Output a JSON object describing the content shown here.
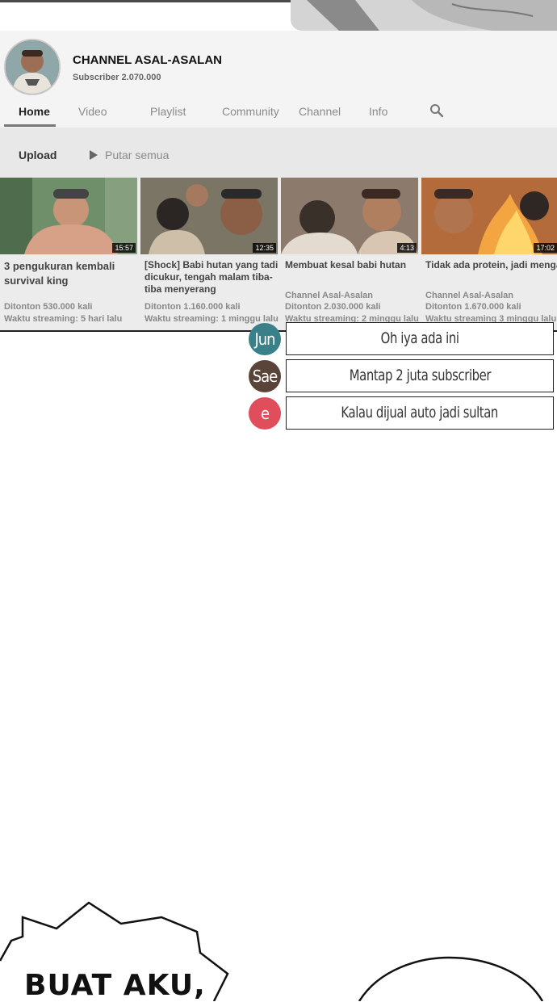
{
  "channel": {
    "name": "CHANNEL ASAL-ASALAN",
    "subscribers": "Subscriber 2.070.000"
  },
  "tabs": [
    "Home",
    "Video",
    "Playlist",
    "Community",
    "Channel",
    "Info"
  ],
  "upload_row": {
    "label": "Upload",
    "play_all": "Putar semua"
  },
  "videos": [
    {
      "title": "3 pengukuran kembali survival king",
      "duration": "15:57",
      "channel": "",
      "views": "Ditonton 530.000 kali",
      "time": "Waktu streaming: 5 hari lalu"
    },
    {
      "title": "[Shock] Babi hutan yang tadi dicukur, tengah malam tiba-tiba menyerang",
      "duration": "12:35",
      "channel": "",
      "views": "Ditonton 1.160.000 kali",
      "time": "Waktu streaming: 1 minggu lalu"
    },
    {
      "title": "Membuat kesal babi hutan",
      "duration": "4:13",
      "channel": "Channel Asal-Asalan",
      "views": "Ditonton 2.030.000 kali",
      "time": "Waktu streaming: 2 minggu lalu"
    },
    {
      "title": "Tidak ada protein, jadi mengamuk",
      "duration": "17:02",
      "channel": "Channel Asal-Asalan",
      "views": "Ditonton 1.670.000 kali",
      "time": "Waktu streaming 3 minggu lalu"
    }
  ],
  "chat": [
    {
      "user": "Jun",
      "message": "Oh iya ada ini",
      "color": "#3a8089"
    },
    {
      "user": "Sae",
      "message": "Mantap 2 juta subscriber",
      "color": "#5a4339"
    },
    {
      "user": "e",
      "message": "Kalau dijual auto jadi sultan",
      "color": "#e04e5c"
    }
  ],
  "comic": {
    "speech_text": "BUAT AKU,"
  },
  "colors": {
    "divider": "#222222",
    "header_bg": "#f4f4f4"
  }
}
